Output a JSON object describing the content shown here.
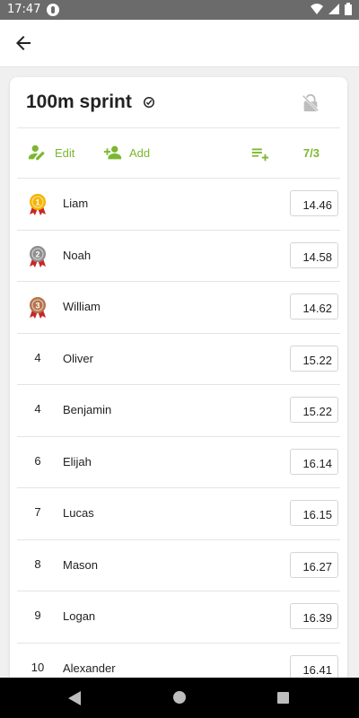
{
  "status_bar": {
    "time": "17:47"
  },
  "event": {
    "title": "100m sprint",
    "actions": {
      "edit_label": "Edit",
      "add_label": "Add",
      "counter": "7/3"
    }
  },
  "results": [
    {
      "rank": "1",
      "medal": "gold",
      "name": "Liam",
      "time": "14.46"
    },
    {
      "rank": "2",
      "medal": "silver",
      "name": "Noah",
      "time": "14.58"
    },
    {
      "rank": "3",
      "medal": "bronze",
      "name": "William",
      "time": "14.62"
    },
    {
      "rank": "4",
      "medal": "",
      "name": "Oliver",
      "time": "15.22"
    },
    {
      "rank": "4",
      "medal": "",
      "name": "Benjamin",
      "time": "15.22"
    },
    {
      "rank": "6",
      "medal": "",
      "name": "Elijah",
      "time": "16.14"
    },
    {
      "rank": "7",
      "medal": "",
      "name": "Lucas",
      "time": "16.15"
    },
    {
      "rank": "8",
      "medal": "",
      "name": "Mason",
      "time": "16.27"
    },
    {
      "rank": "9",
      "medal": "",
      "name": "Logan",
      "time": "16.39"
    },
    {
      "rank": "10",
      "medal": "",
      "name": "Alexander",
      "time": "16.41"
    }
  ],
  "colors": {
    "accent": "#7cb82f",
    "gold": "#f4b400",
    "silver": "#8e8e8e",
    "bronze": "#b5734a"
  }
}
